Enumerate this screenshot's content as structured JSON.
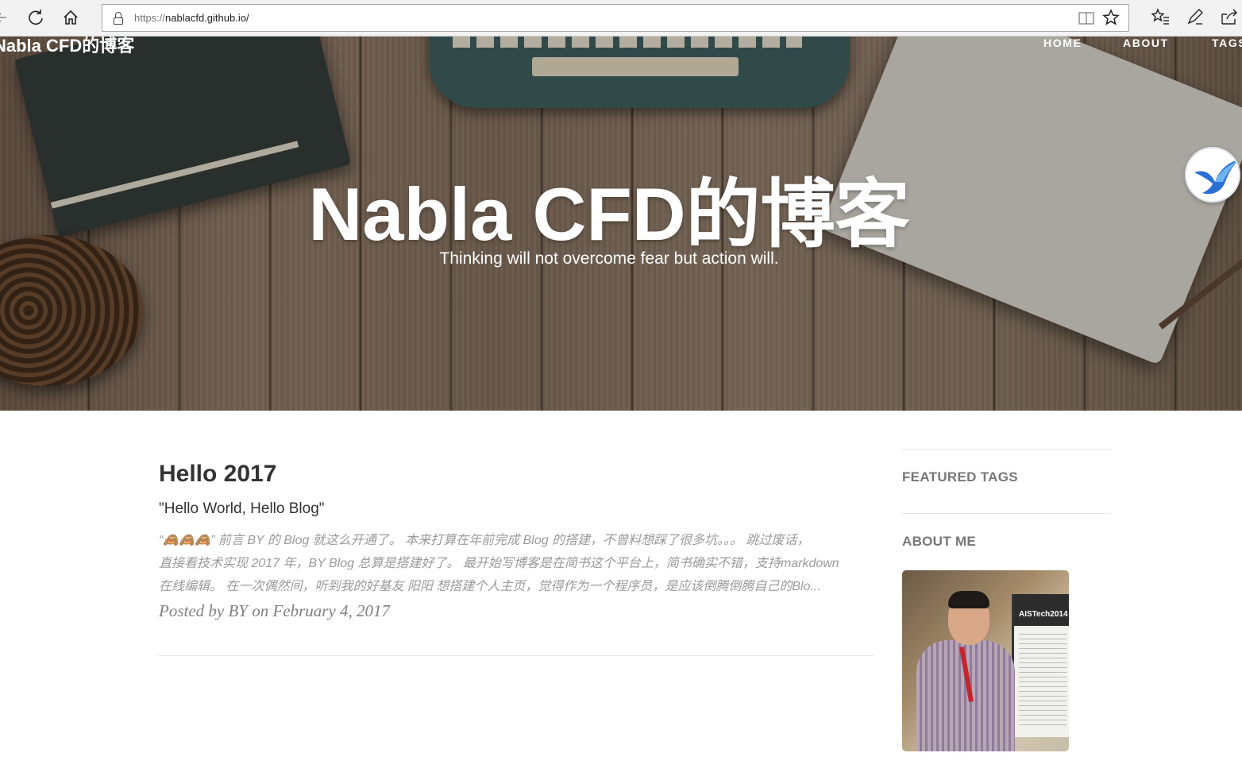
{
  "browser": {
    "url_protocol": "https://",
    "url_host": "nablacfd.github.io/",
    "icons": {
      "back": "back-arrow-icon",
      "refresh": "refresh-icon",
      "home": "home-icon",
      "lock": "lock-icon",
      "reader": "reading-view-icon",
      "favorite": "star-icon",
      "favorites_hub": "favorites-list-icon",
      "notes": "pen-icon",
      "share": "share-icon"
    }
  },
  "site": {
    "brand": "Nabla CFD的博客",
    "nav": {
      "home": "HOME",
      "about": "ABOUT",
      "tags": "TAGS"
    }
  },
  "hero": {
    "title": "Nabla CFD的博客",
    "subtitle": "Thinking will not overcome fear but action will."
  },
  "post": {
    "title": "Hello 2017",
    "subtitle": "\"Hello World, Hello Blog\"",
    "excerpt_line1": "“🙈🙈🙈” 前言 BY 的 Blog 就这么开通了。 本来打算在年前完成 Blog 的搭建，不曾料想踩了很多坑。。。 跳过废话，",
    "excerpt_line2": "直接看技术实现 2017 年，BY Blog 总算是搭建好了。 最开始写博客是在简书这个平台上，简书确实不错，支持markdown",
    "excerpt_line3": "在线编辑。 在一次偶然间，听到我的好基友 阳阳 想搭建个人主页，觉得作为一个程序员，是应该倒腾倒腾自己的Blo...",
    "meta": "Posted by BY on February 4, 2017"
  },
  "sidebar": {
    "featured_tags": "FEATURED TAGS",
    "about_me": "ABOUT ME",
    "poster_text": "AISTech2014"
  },
  "colors": {
    "text_dark": "#333333",
    "text_muted": "#9a9a9a",
    "sidebar_heading": "#777777",
    "hero_text": "#ffffff",
    "badge_blue": "#2a6fd6"
  }
}
